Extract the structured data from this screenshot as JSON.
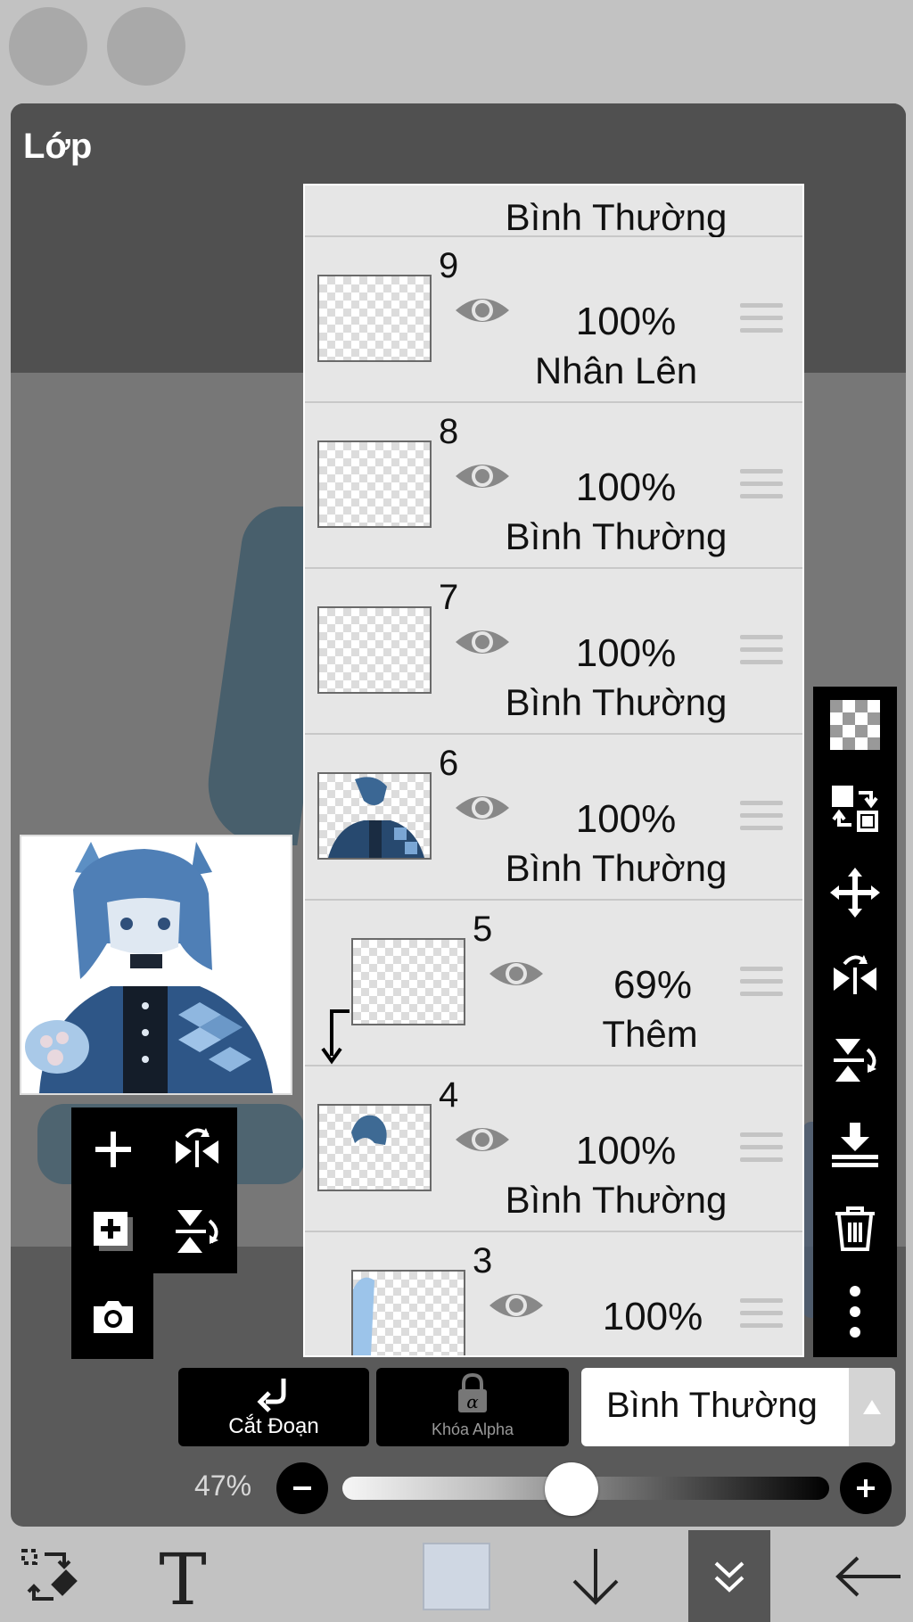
{
  "panel": {
    "title": "Lớp"
  },
  "layers": [
    {
      "num": "",
      "opacity": "",
      "mode": "Bình Thường"
    },
    {
      "num": "9",
      "opacity": "100%",
      "mode": "Nhân Lên"
    },
    {
      "num": "8",
      "opacity": "100%",
      "mode": "Bình Thường"
    },
    {
      "num": "7",
      "opacity": "100%",
      "mode": "Bình Thường"
    },
    {
      "num": "6",
      "opacity": "100%",
      "mode": "Bình Thường"
    },
    {
      "num": "5",
      "opacity": "69%",
      "mode": "Thêm",
      "clipped": true
    },
    {
      "num": "4",
      "opacity": "100%",
      "mode": "Bình Thường"
    },
    {
      "num": "3",
      "opacity": "100%",
      "mode": ""
    }
  ],
  "actions": {
    "clip_label": "Cắt Đoạn",
    "alpha_lock_label": "Khóa Alpha",
    "blend_mode": "Bình Thường"
  },
  "opacity": {
    "label": "47%",
    "value": 0.47
  },
  "right_toolbar": [
    "checkerboard-icon",
    "transfer-layer-icon",
    "move-icon",
    "flip-horizontal-icon",
    "flip-vertical-icon",
    "merge-down-icon",
    "trash-icon",
    "more-icon"
  ],
  "left_toolbar": [
    "add-layer-icon",
    "flip-horizontal-icon",
    "duplicate-layer-icon",
    "flip-vertical-icon",
    "camera-icon"
  ],
  "bottom_toolbar": [
    "transform-eraser-icon",
    "text-icon",
    "color-swatch",
    "arrow-down-icon",
    "double-chevron-down-icon",
    "back-arrow-icon"
  ],
  "colors": {
    "accent_blue": "#4f7fb6",
    "swatch": "#cfd7e3",
    "panel": "#5a5a5a",
    "list_bg": "#e6e6e6"
  }
}
